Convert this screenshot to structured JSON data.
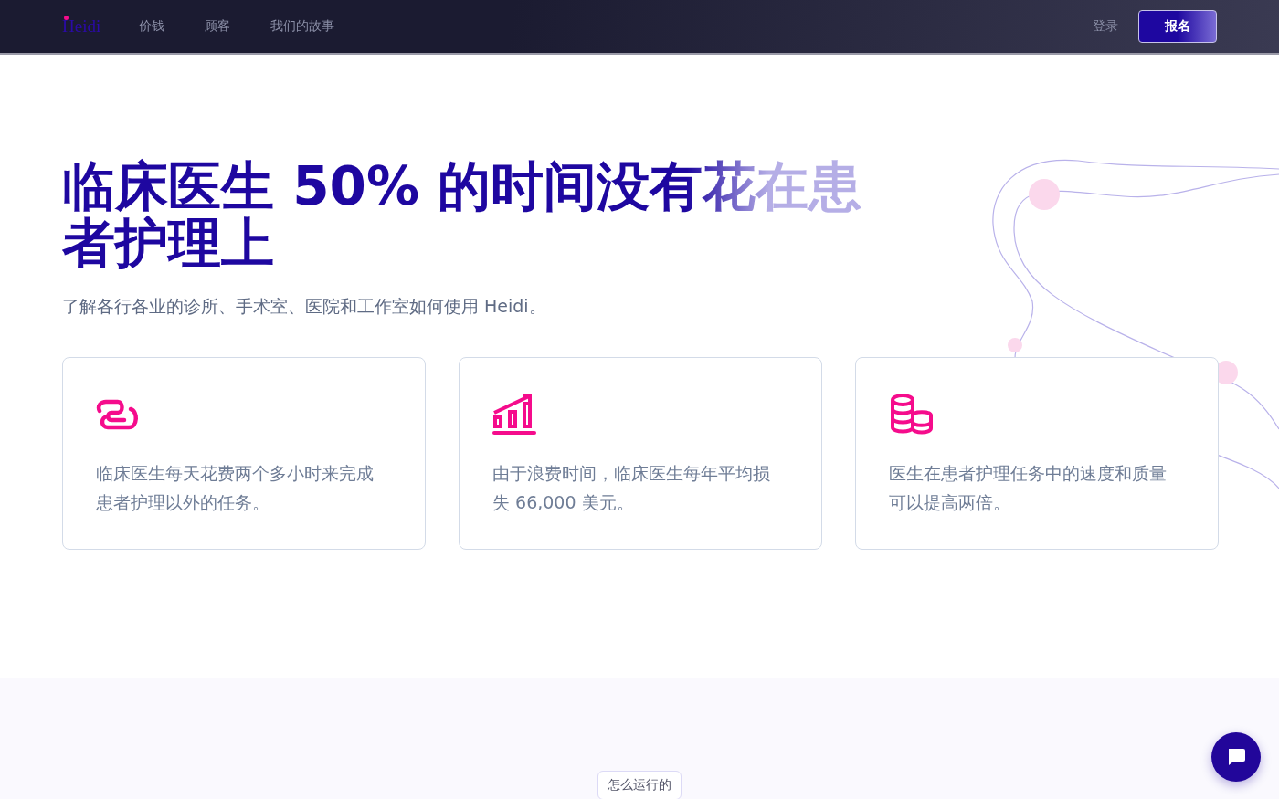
{
  "nav": {
    "logo": "Heidi",
    "links": [
      {
        "label": "价钱"
      },
      {
        "label": "顾客"
      },
      {
        "label": "我们的故事"
      }
    ],
    "login": "登录",
    "signup": "报名"
  },
  "hero": {
    "title": "临床医生 50% 的时间没有花在患者护理上",
    "subtitle": "了解各行各业的诊所、手术室、医院和工作室如何使用 Heidi。"
  },
  "cards": [
    {
      "kind": "link",
      "text": "临床医生每天花费两个多小时来完成患者护理以外的任务。"
    },
    {
      "kind": "chart",
      "text": "由于浪费时间，临床医生每年平均损失 66,000 美元。"
    },
    {
      "kind": "coins",
      "text": "医生在患者护理任务中的速度和质量可以提高两倍。"
    }
  ],
  "section": {
    "tag": "怎么运行的"
  }
}
